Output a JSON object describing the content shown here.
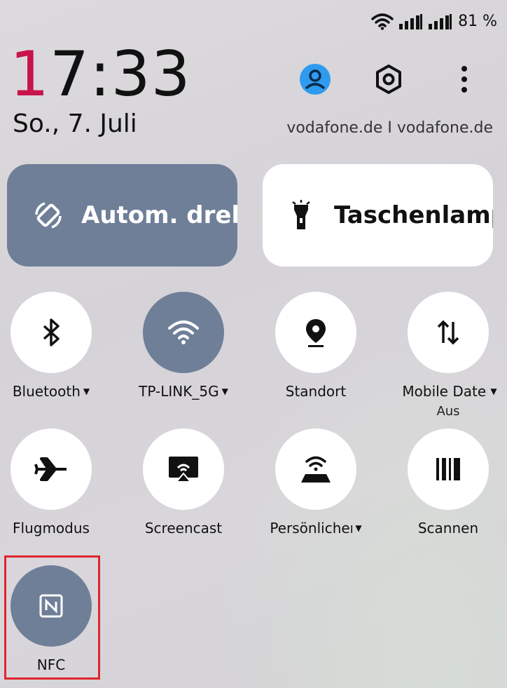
{
  "status": {
    "battery": "81 %"
  },
  "clock": {
    "hour_first": "1",
    "rest": "7:33",
    "date": "So., 7. Juli"
  },
  "carrier": "vodafone.de I vodafone.de",
  "icons": {
    "user": "user-icon",
    "settings": "settings-icon",
    "more": "more-icon"
  },
  "big_tiles": [
    {
      "label": "Autom. drehen",
      "icon": "rotate-icon",
      "active": true
    },
    {
      "label": "Taschenlampe",
      "icon": "flashlight-icon",
      "active": false
    }
  ],
  "tiles": [
    {
      "label": "Bluetooth",
      "dropdown": true,
      "icon": "bluetooth-icon",
      "active": false
    },
    {
      "label": "TP-LINK_5G",
      "dropdown": true,
      "icon": "wifi-icon",
      "active": true
    },
    {
      "label": "Standort",
      "dropdown": false,
      "icon": "location-icon",
      "active": false
    },
    {
      "label": "Mobile Daten",
      "dropdown": true,
      "sub": "Aus",
      "icon": "mobile-data-icon",
      "active": false
    },
    {
      "label": "Flugmodus",
      "dropdown": false,
      "icon": "airplane-icon",
      "active": false
    },
    {
      "label": "Screencast",
      "dropdown": false,
      "icon": "screencast-icon",
      "active": false
    },
    {
      "label": "Persönlicher Hotspot",
      "dropdown": true,
      "icon": "hotspot-icon",
      "active": false
    },
    {
      "label": "Scannen",
      "dropdown": false,
      "icon": "scan-icon",
      "active": false
    },
    {
      "label": "NFC",
      "dropdown": false,
      "icon": "nfc-icon",
      "active": true
    }
  ],
  "colors": {
    "accent": "#6f7f98",
    "clock_accent": "#c8134b",
    "highlight": "#e0252c",
    "user_icon": "#2f9bf0"
  }
}
